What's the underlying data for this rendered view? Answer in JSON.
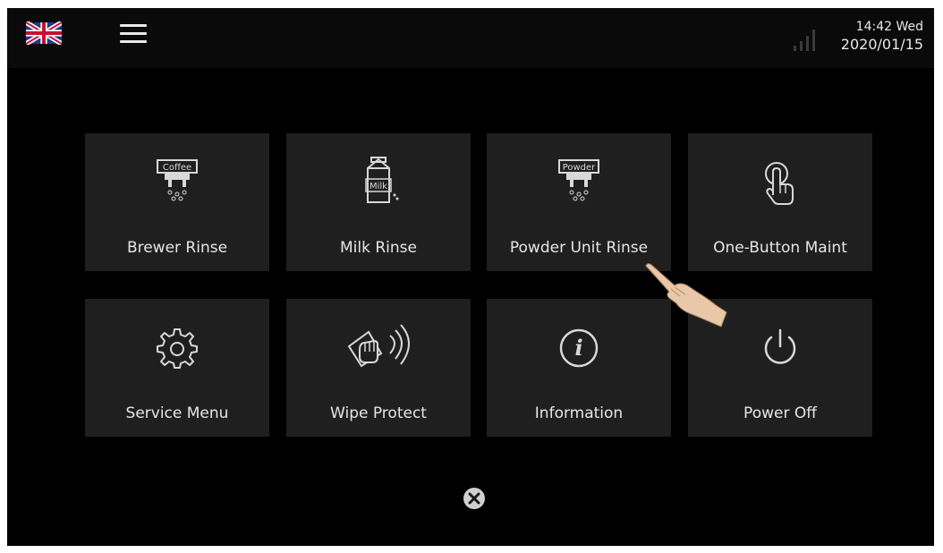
{
  "header": {
    "language_icon": "uk-flag-icon",
    "menu_icon": "hamburger-menu-icon",
    "signal_icon": "signal-strength-icon",
    "time": "14:42 Wed",
    "date": "2020/01/15"
  },
  "tiles": [
    {
      "label": "Brewer Rinse",
      "icon": "coffee-brewer-rinse-icon",
      "icon_text": "Coffee"
    },
    {
      "label": "Milk Rinse",
      "icon": "milk-carton-icon",
      "icon_text": "Milk"
    },
    {
      "label": "Powder Unit Rinse",
      "icon": "powder-unit-rinse-icon",
      "icon_text": "Powder"
    },
    {
      "label": "One-Button Maint",
      "icon": "touch-button-icon"
    },
    {
      "label": "Service Menu",
      "icon": "gear-icon"
    },
    {
      "label": "Wipe Protect",
      "icon": "wipe-hand-icon"
    },
    {
      "label": "Information",
      "icon": "info-icon"
    },
    {
      "label": "Power Off",
      "icon": "power-icon"
    }
  ],
  "close_icon": "close-icon",
  "pointer_icon": "pointing-hand-icon",
  "colors": {
    "background": "#000000",
    "tile": "#1f1f1f",
    "text": "#e6e6e6",
    "icon": "#d8d8d8"
  }
}
